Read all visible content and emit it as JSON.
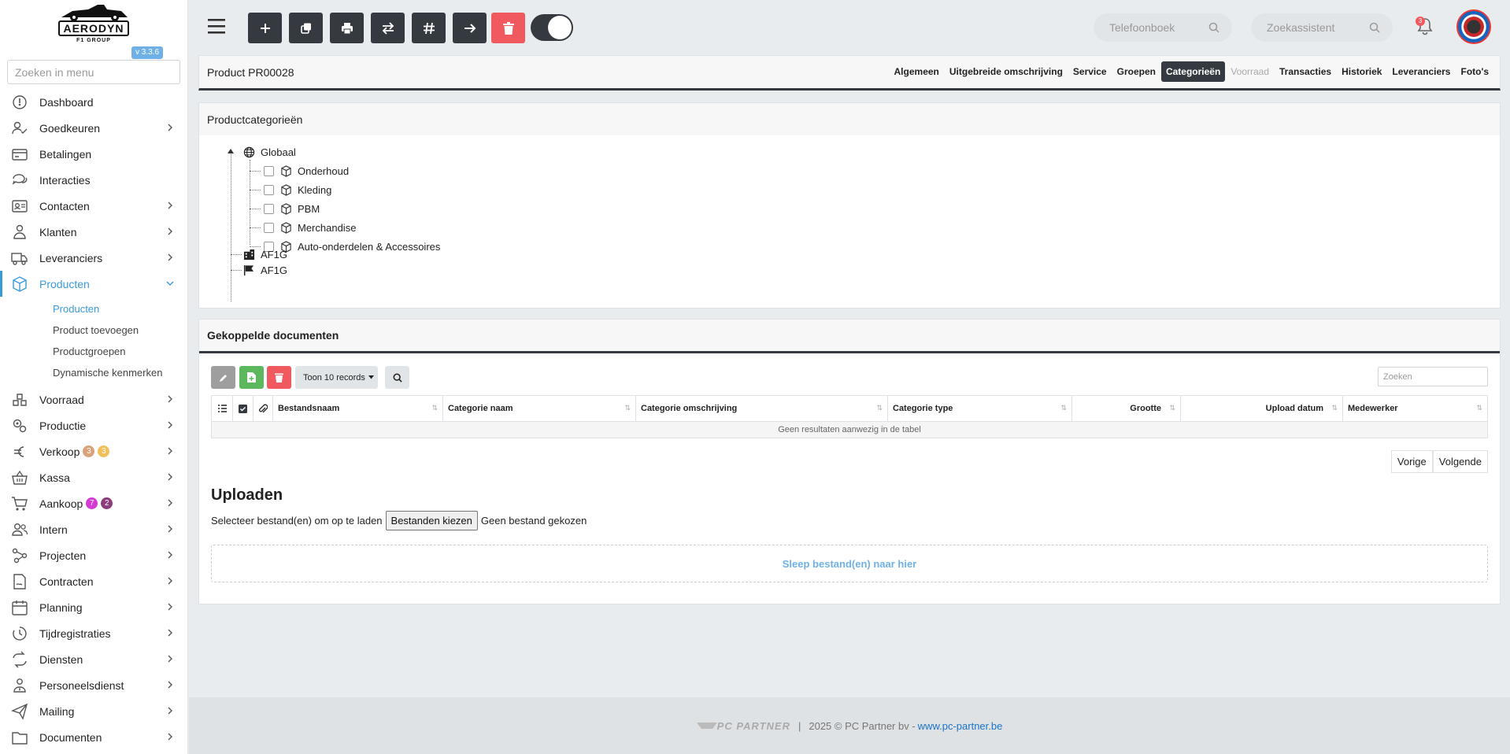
{
  "brand": {
    "logo_text": "AERODYN",
    "logo_sub": "F1 GROUP",
    "version": "v 3.3.6"
  },
  "menu_search": {
    "placeholder": "Zoeken in menu"
  },
  "nav": [
    {
      "label": "Dashboard",
      "icon": "dashboard-icon",
      "chevron": false
    },
    {
      "label": "Goedkeuren",
      "icon": "approve-icon",
      "chevron": true
    },
    {
      "label": "Betalingen",
      "icon": "payments-icon",
      "chevron": false
    },
    {
      "label": "Interacties",
      "icon": "chat-icon",
      "chevron": false
    },
    {
      "label": "Contacten",
      "icon": "contacts-icon",
      "chevron": true
    },
    {
      "label": "Klanten",
      "icon": "customers-icon",
      "chevron": true
    },
    {
      "label": "Leveranciers",
      "icon": "truck-icon",
      "chevron": true
    },
    {
      "label": "Producten",
      "icon": "box-icon",
      "chevron": true,
      "active": true
    },
    {
      "label": "Voorraad",
      "icon": "stock-icon",
      "chevron": true
    },
    {
      "label": "Productie",
      "icon": "gears-icon",
      "chevron": true
    },
    {
      "label": "Verkoop",
      "icon": "euro-icon",
      "chevron": true,
      "badges": [
        {
          "text": "3",
          "color": "#d9a27a"
        },
        {
          "text": "3",
          "color": "#f0c05a"
        }
      ]
    },
    {
      "label": "Kassa",
      "icon": "basket-icon",
      "chevron": true
    },
    {
      "label": "Aankoop",
      "icon": "cart-icon",
      "chevron": true,
      "badges": [
        {
          "text": "7",
          "color": "#d63ad6"
        },
        {
          "text": "2",
          "color": "#8a3d7a"
        }
      ]
    },
    {
      "label": "Intern",
      "icon": "users-icon",
      "chevron": true
    },
    {
      "label": "Projecten",
      "icon": "project-icon",
      "chevron": true
    },
    {
      "label": "Contracten",
      "icon": "contract-icon",
      "chevron": true
    },
    {
      "label": "Planning",
      "icon": "calendar-icon",
      "chevron": true
    },
    {
      "label": "Tijdregistraties",
      "icon": "timer-icon",
      "chevron": true
    },
    {
      "label": "Diensten",
      "icon": "repeat-icon",
      "chevron": true
    },
    {
      "label": "Personeelsdienst",
      "icon": "staff-icon",
      "chevron": true
    },
    {
      "label": "Mailing",
      "icon": "send-icon",
      "chevron": true
    },
    {
      "label": "Documenten",
      "icon": "folder-icon",
      "chevron": true
    }
  ],
  "subnav": [
    {
      "label": "Producten",
      "active": true
    },
    {
      "label": "Product toevoegen"
    },
    {
      "label": "Productgroepen"
    },
    {
      "label": "Dynamische kenmerken"
    }
  ],
  "topbar": {
    "phonebook_placeholder": "Telefoonboek",
    "assistant_placeholder": "Zoekassistent",
    "notifications": "3"
  },
  "product": {
    "title": "Product PR00028",
    "tabs": [
      {
        "label": "Algemeen"
      },
      {
        "label": "Uitgebreide omschrijving"
      },
      {
        "label": "Service"
      },
      {
        "label": "Groepen"
      },
      {
        "label": "Categorieën",
        "active": true
      },
      {
        "label": "Voorraad",
        "disabled": true
      },
      {
        "label": "Transacties"
      },
      {
        "label": "Historiek"
      },
      {
        "label": "Leveranciers"
      },
      {
        "label": "Foto's"
      }
    ]
  },
  "categories": {
    "title": "Productcategorieën",
    "root": "Globaal",
    "children": [
      "Onderhoud",
      "Kleding",
      "PBM",
      "Merchandise",
      "Auto-onderdelen & Accessoires"
    ],
    "company": "AF1G",
    "flag": "AF1G"
  },
  "documents": {
    "title": "Gekoppelde documenten",
    "show_records": "Toon 10 records",
    "filter_placeholder": "Zoeken",
    "columns": [
      "Bestandsnaam",
      "Categorie naam",
      "Categorie omschrijving",
      "Categorie type",
      "Grootte",
      "Upload datum",
      "Medewerker"
    ],
    "empty": "Geen resultaten aanwezig in de tabel",
    "prev": "Vorige",
    "next": "Volgende"
  },
  "upload": {
    "title": "Uploaden",
    "select_label": "Selecteer bestand(en) om op te laden",
    "choose_button": "Bestanden kiezen",
    "no_file": "Geen bestand gekozen",
    "dropzone": "Sleep bestand(en) naar hier"
  },
  "footer": {
    "brand": "PC PARTNER",
    "separator": "|",
    "copyright": "2025 © PC Partner bv -",
    "link": "www.pc-partner.be"
  }
}
